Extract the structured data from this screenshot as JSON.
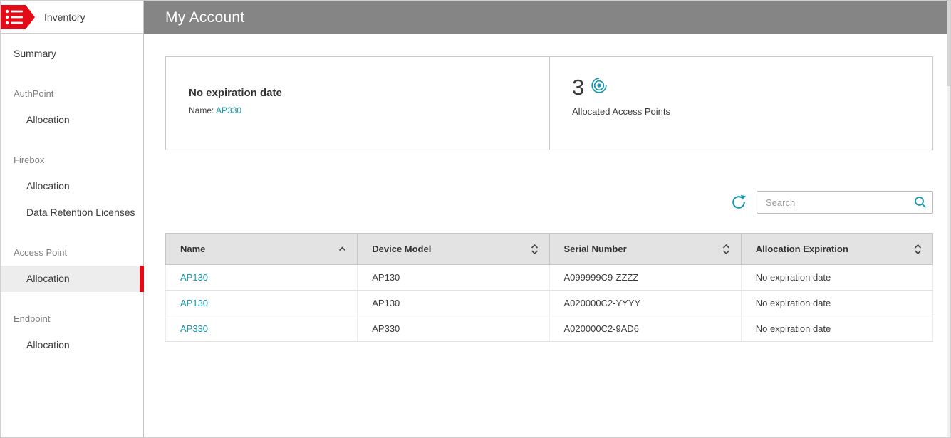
{
  "sidebar": {
    "logo_label": "Inventory",
    "items": [
      {
        "label": "Summary",
        "type": "item"
      },
      {
        "label": "AuthPoint",
        "type": "section"
      },
      {
        "label": "Allocation",
        "type": "subitem"
      },
      {
        "label": "Firebox",
        "type": "section"
      },
      {
        "label": "Allocation",
        "type": "subitem"
      },
      {
        "label": "Data Retention Licenses",
        "type": "subitem"
      },
      {
        "label": "Access Point",
        "type": "section"
      },
      {
        "label": "Allocation",
        "type": "subitem",
        "selected": true
      },
      {
        "label": "Endpoint",
        "type": "section"
      },
      {
        "label": "Allocation",
        "type": "subitem"
      }
    ]
  },
  "header": {
    "title": "My Account"
  },
  "cards": {
    "expiration": {
      "title": "No expiration date",
      "name_label": "Name:",
      "name_value": "AP330"
    },
    "allocated": {
      "count": "3",
      "label": "Allocated Access Points"
    }
  },
  "toolbar": {
    "search_placeholder": "Search"
  },
  "table": {
    "columns": [
      {
        "label": "Name",
        "sort": "asc"
      },
      {
        "label": "Device Model",
        "sort": "both"
      },
      {
        "label": "Serial Number",
        "sort": "both"
      },
      {
        "label": "Allocation Expiration",
        "sort": "both"
      }
    ],
    "rows": [
      {
        "name": "AP130",
        "model": "AP130",
        "serial": "A099999C9-ZZZZ",
        "expiration": "No expiration date"
      },
      {
        "name": "AP130",
        "model": "AP130",
        "serial": "A020000C2-YYYY",
        "expiration": "No expiration date"
      },
      {
        "name": "AP330",
        "model": "AP330",
        "serial": "A020000C2-9AD6",
        "expiration": "No expiration date"
      }
    ]
  },
  "colors": {
    "accent_teal": "#1697ab",
    "brand_red": "#e30b17",
    "header_gray": "#858585",
    "selected_item_bg": "#ededed",
    "table_header_bg": "#e3e3e3"
  }
}
